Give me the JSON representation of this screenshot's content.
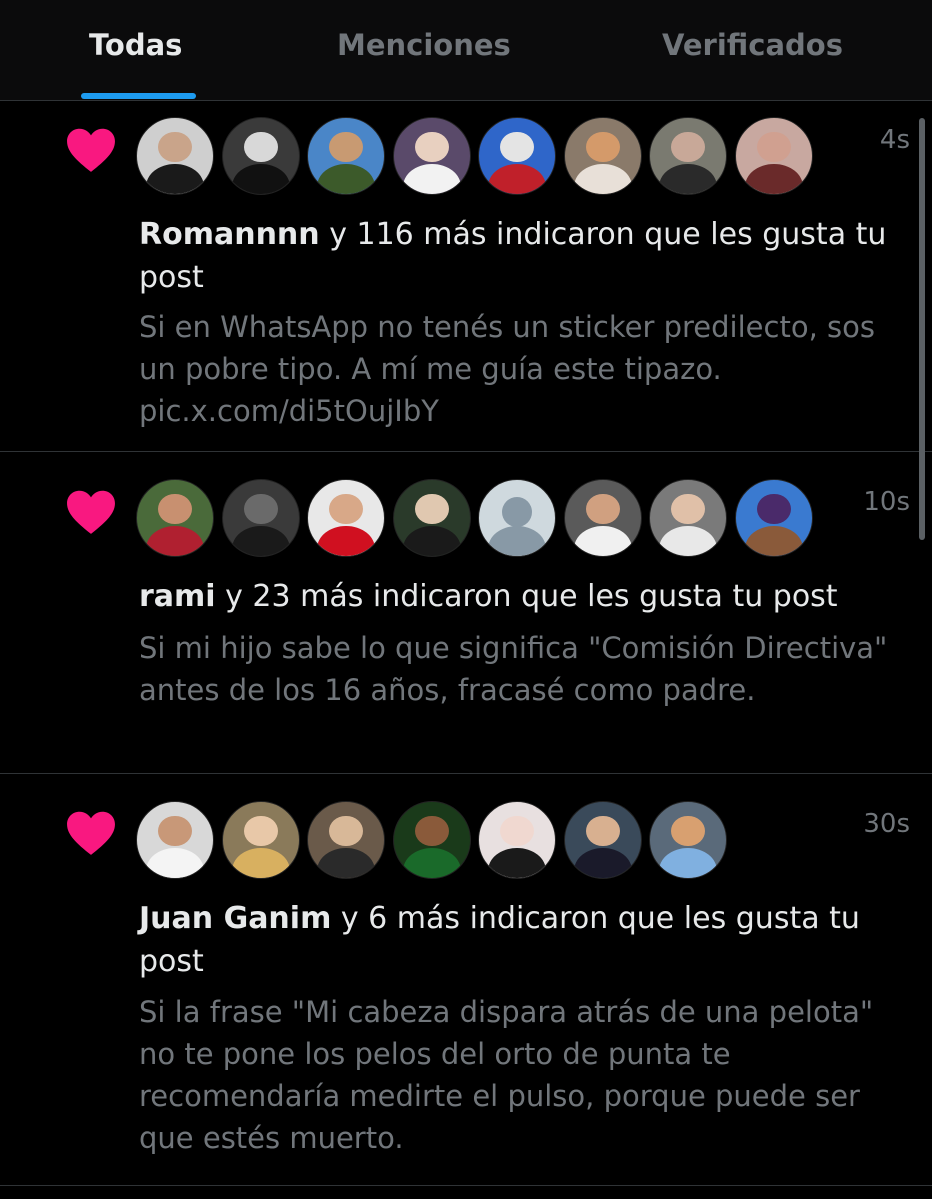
{
  "tabs": [
    {
      "label": "Todas",
      "active": true
    },
    {
      "label": "Menciones",
      "active": false
    },
    {
      "label": "Verificados",
      "active": false
    }
  ],
  "notifications": [
    {
      "icon": "heart-icon",
      "time": "4s",
      "user": "Romannnn",
      "action": " y 116 más indicaron que les gusta tu post",
      "post_text": "Si en WhatsApp no tenés un sticker predilecto, sos un pobre tipo. A mí me guía este tipazo. pic.x.com/di5tOujIbY",
      "avatars": [
        {
          "bg": "#cfcfcf",
          "face": "#c9a48a",
          "body": "#1a1a1a"
        },
        {
          "bg": "#3a3a3a",
          "face": "#d8d8d8",
          "body": "#111"
        },
        {
          "bg": "#4a86c8",
          "face": "#c89a72",
          "body": "#3c5a2a"
        },
        {
          "bg": "#5a4a6a",
          "face": "#e8d0c0",
          "body": "#f2f2f2"
        },
        {
          "bg": "#2f66c9",
          "face": "#e4e4e4",
          "body": "#c0202a"
        },
        {
          "bg": "#8a7a6a",
          "face": "#d49a6a",
          "body": "#e8e0d8"
        },
        {
          "bg": "#7a7a70",
          "face": "#c8a898",
          "body": "#2a2a2a"
        },
        {
          "bg": "#c8a8a0",
          "face": "#d0a090",
          "body": "#6a2a2a"
        }
      ]
    },
    {
      "icon": "heart-icon",
      "time": "10s",
      "user": "rami",
      "action": " y 23 más indicaron que les gusta tu post",
      "post_text": "Si mi hijo sabe lo que significa \"Comisión Directiva\" antes de los 16 años, fracasé como padre.",
      "avatars": [
        {
          "bg": "#4a6a3a",
          "face": "#c89070",
          "body": "#b02030"
        },
        {
          "bg": "#3a3a3a",
          "face": "#6a6a6a",
          "body": "#1a1a1a"
        },
        {
          "bg": "#e8e8e8",
          "face": "#d8a888",
          "body": "#d01020"
        },
        {
          "bg": "#2a3a2a",
          "face": "#e0c8b0",
          "body": "#1a1a1a"
        },
        {
          "default": true
        },
        {
          "bg": "#5a5a5a",
          "face": "#d0a080",
          "body": "#f0f0f0"
        },
        {
          "bg": "#7a7a7a",
          "face": "#e0c0a8",
          "body": "#e8e8e8"
        },
        {
          "bg": "#3a7ad0",
          "face": "#4a2a6a",
          "body": "#8a5a3a"
        }
      ]
    },
    {
      "icon": "heart-icon",
      "time": "30s",
      "user": "Juan Ganim",
      "action": " y 6 más indicaron que les gusta tu post",
      "post_text": "Si la frase \"Mi cabeza dispara atrás de una pelota\" no te pone los pelos del orto de punta te recomendaría medirte el pulso, porque puede ser que estés muerto.",
      "avatars": [
        {
          "bg": "#d8d8d8",
          "face": "#c89878",
          "body": "#f4f4f4"
        },
        {
          "bg": "#8a7a5a",
          "face": "#e8c8a8",
          "body": "#d8b060"
        },
        {
          "bg": "#6a5a4a",
          "face": "#d8b898",
          "body": "#2a2a2a"
        },
        {
          "bg": "#1a3a1a",
          "face": "#8a5a3a",
          "body": "#1a6a2a"
        },
        {
          "bg": "#e8e0e0",
          "face": "#f0d8d0",
          "body": "#1a1a1a"
        },
        {
          "bg": "#3a4a5a",
          "face": "#d8b090",
          "body": "#1a1a2a"
        },
        {
          "bg": "#5a6a7a",
          "face": "#d8a070",
          "body": "#80b0e0"
        }
      ]
    }
  ]
}
